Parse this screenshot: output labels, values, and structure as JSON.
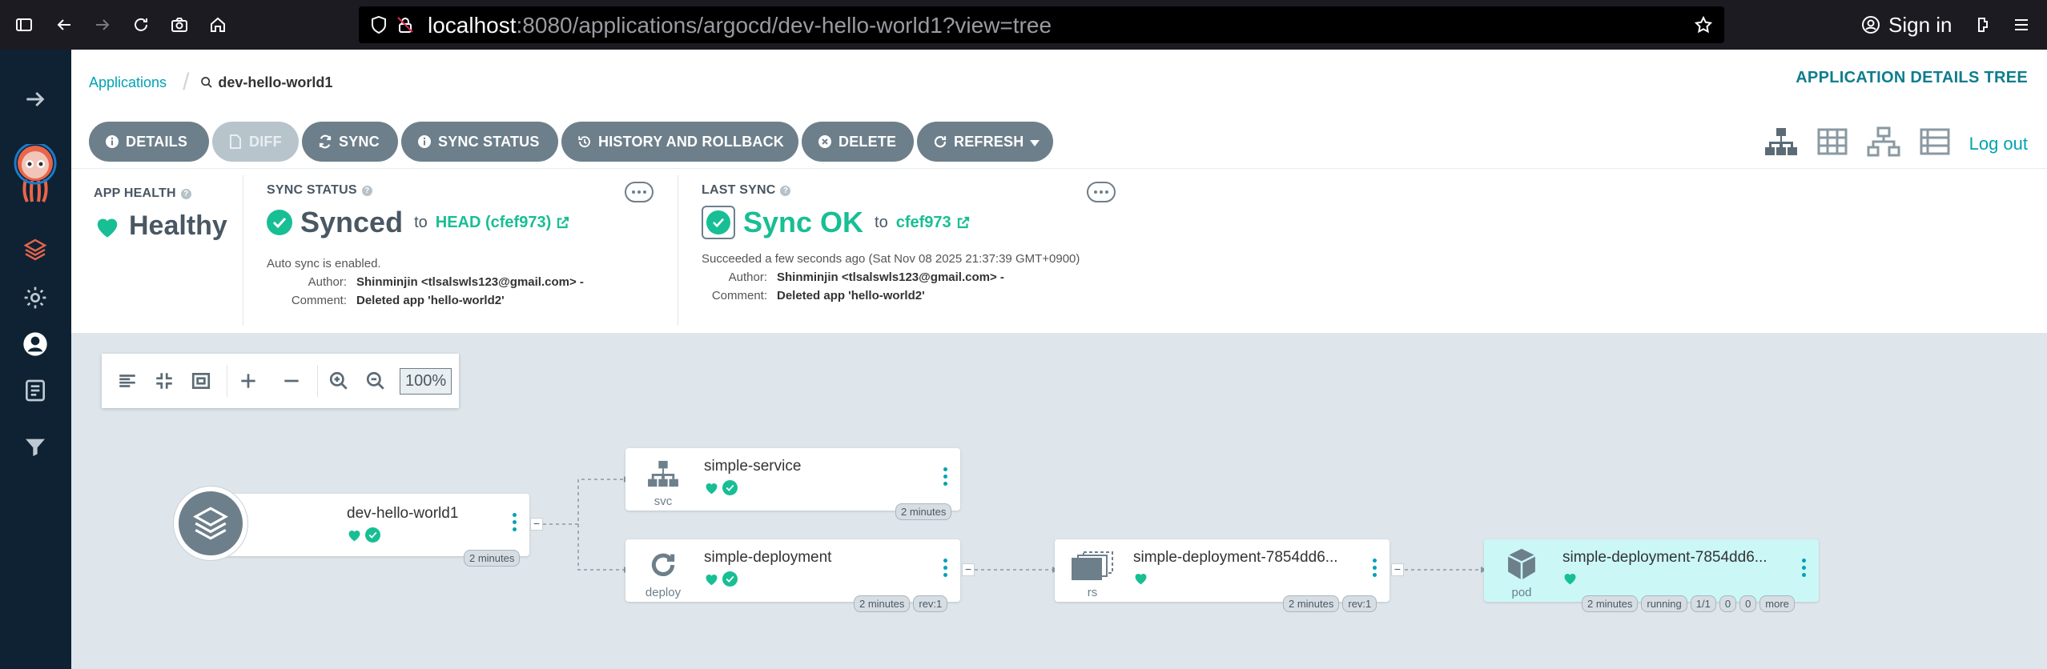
{
  "browser": {
    "url_host": "localhost",
    "url_rest": ":8080/applications/argocd/dev-hello-world1?view=tree",
    "signin_label": "Sign in"
  },
  "breadcrumb": {
    "root": "Applications",
    "current": "dev-hello-world1"
  },
  "page_title": "APPLICATION DETAILS TREE",
  "toolbar": {
    "details": "DETAILS",
    "diff": "DIFF",
    "sync": "SYNC",
    "sync_status": "SYNC STATUS",
    "history": "HISTORY AND ROLLBACK",
    "delete": "DELETE",
    "refresh": "REFRESH"
  },
  "logout_label": "Log out",
  "app_health": {
    "label": "APP HEALTH",
    "value": "Healthy"
  },
  "sync_status": {
    "label": "SYNC STATUS",
    "value": "Synced",
    "to": "to",
    "revision": "HEAD (cfef973)",
    "auto_sync": "Auto sync is enabled.",
    "author_key": "Author:",
    "author": "Shinminjin <tlsalswls123@gmail.com> -",
    "comment_key": "Comment:",
    "comment": "Deleted app 'hello-world2'"
  },
  "last_sync": {
    "label": "LAST SYNC",
    "value": "Sync OK",
    "to": "to",
    "revision": "cfef973",
    "when": "Succeeded a few seconds ago (Sat Nov 08 2025 21:37:39 GMT+0900)",
    "author_key": "Author:",
    "author": "Shinminjin <tlsalswls123@gmail.com> -",
    "comment_key": "Comment:",
    "comment": "Deleted app 'hello-world2'"
  },
  "zoom_value": "100%",
  "tree": {
    "app": {
      "name": "dev-hello-world1",
      "age": "2 minutes"
    },
    "service": {
      "name": "simple-service",
      "kind": "svc",
      "age": "2 minutes"
    },
    "deployment": {
      "name": "simple-deployment",
      "kind": "deploy",
      "age": "2 minutes",
      "rev": "rev:1"
    },
    "replicaset": {
      "name": "simple-deployment-7854dd6...",
      "kind": "rs",
      "age": "2 minutes",
      "rev": "rev:1"
    },
    "pod": {
      "name": "simple-deployment-7854dd6...",
      "kind": "pod",
      "age": "2 minutes",
      "status": "running",
      "ready": "1/1",
      "restarts": "0",
      "count": "0",
      "more": "more"
    }
  },
  "colors": {
    "accent": "#00a2b3",
    "healthy": "#18be94",
    "button": "#6d7f8b",
    "sidebar": "#0e2233"
  }
}
